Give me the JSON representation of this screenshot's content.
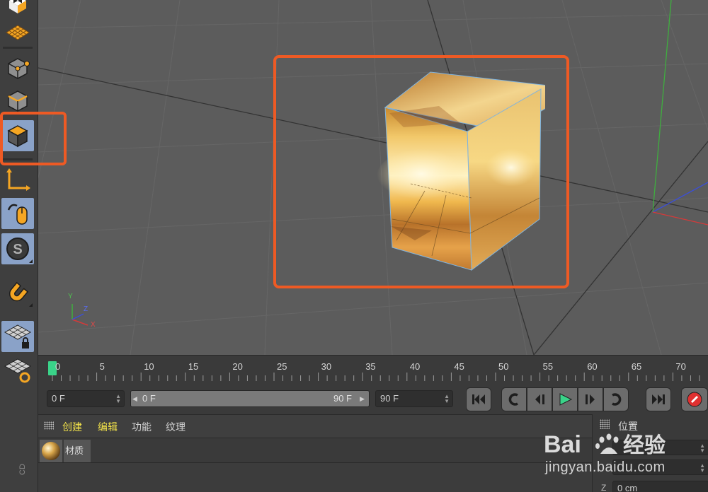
{
  "viewport": {
    "axis_labels": {
      "y": "Y",
      "z": "Z",
      "x": "X"
    }
  },
  "left_toolbar": {
    "tools": [
      "checker-cube-icon",
      "grid-plane-icon",
      "points-mode-icon",
      "edges-mode-icon",
      "model-mode-icon",
      "axis-mode-icon",
      "tweak-mode-icon",
      "solo-icon",
      "snap-icon",
      "workplane-lock-icon",
      "workplane-rotate-icon"
    ],
    "bottom_text": "CD"
  },
  "timeline": {
    "ticks": [
      "0",
      "5",
      "10",
      "15",
      "20",
      "25",
      "30",
      "35",
      "40",
      "45",
      "50",
      "55",
      "60",
      "65",
      "70"
    ],
    "current_frame": "0"
  },
  "transport": {
    "current_frame": "0 F",
    "range_start": "0 F",
    "range_end": "90 F",
    "end_frame": "90 F"
  },
  "material_manager": {
    "menus": [
      "创建",
      "编辑",
      "功能",
      "纹理"
    ],
    "material_name": "材质"
  },
  "attributes": {
    "title": "位置",
    "z_label": "Z",
    "z_value": "0 cm"
  },
  "watermark": {
    "logo_text": "Bai",
    "logo_text2": "经验",
    "url": "jingyan.baidu.com"
  },
  "colors": {
    "highlight": "#ee5a24",
    "tool_active": "#8aa2c8",
    "orange_icon": "#f5a623",
    "playhead": "#3ad389",
    "menu_active": "#f2e24a"
  }
}
